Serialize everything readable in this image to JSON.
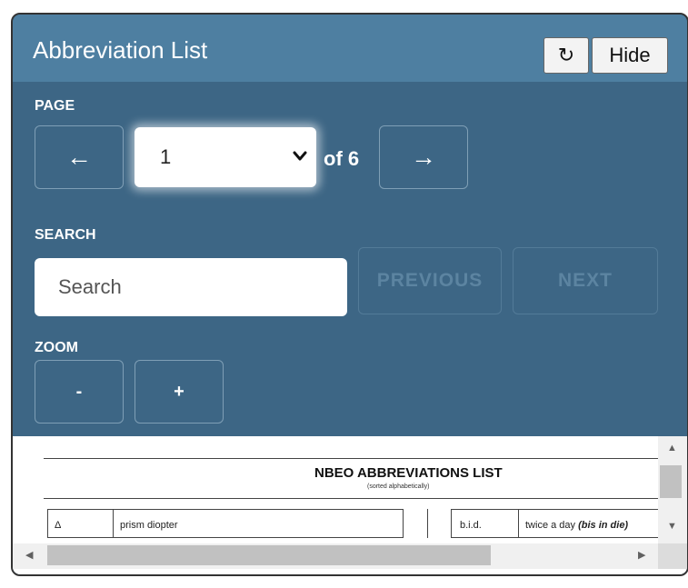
{
  "panel": {
    "title": "Abbreviation List",
    "refresh_icon": "↻",
    "hide_label": "Hide"
  },
  "page": {
    "label": "PAGE",
    "prev_arrow": "←",
    "next_arrow": "→",
    "selected_page": "1",
    "of_text": "of 6"
  },
  "search": {
    "label": "SEARCH",
    "placeholder": "Search",
    "value": "",
    "previous_label": "PREVIOUS",
    "next_label": "NEXT"
  },
  "zoom": {
    "label": "ZOOM",
    "minus_label": "-",
    "plus_label": "+"
  },
  "document": {
    "title": "NBEO ABBREVIATIONS LIST",
    "subtitle": "(sorted alphabetically)",
    "rows": [
      {
        "abbr": "Δ",
        "meaning": "prism diopter",
        "abbr2": "b.i.d.",
        "meaning2": "twice a day",
        "note2": "(bis in die)"
      }
    ]
  },
  "colors": {
    "panel_bg": "#3d6685",
    "titlebar_bg": "#4e7fa1"
  }
}
